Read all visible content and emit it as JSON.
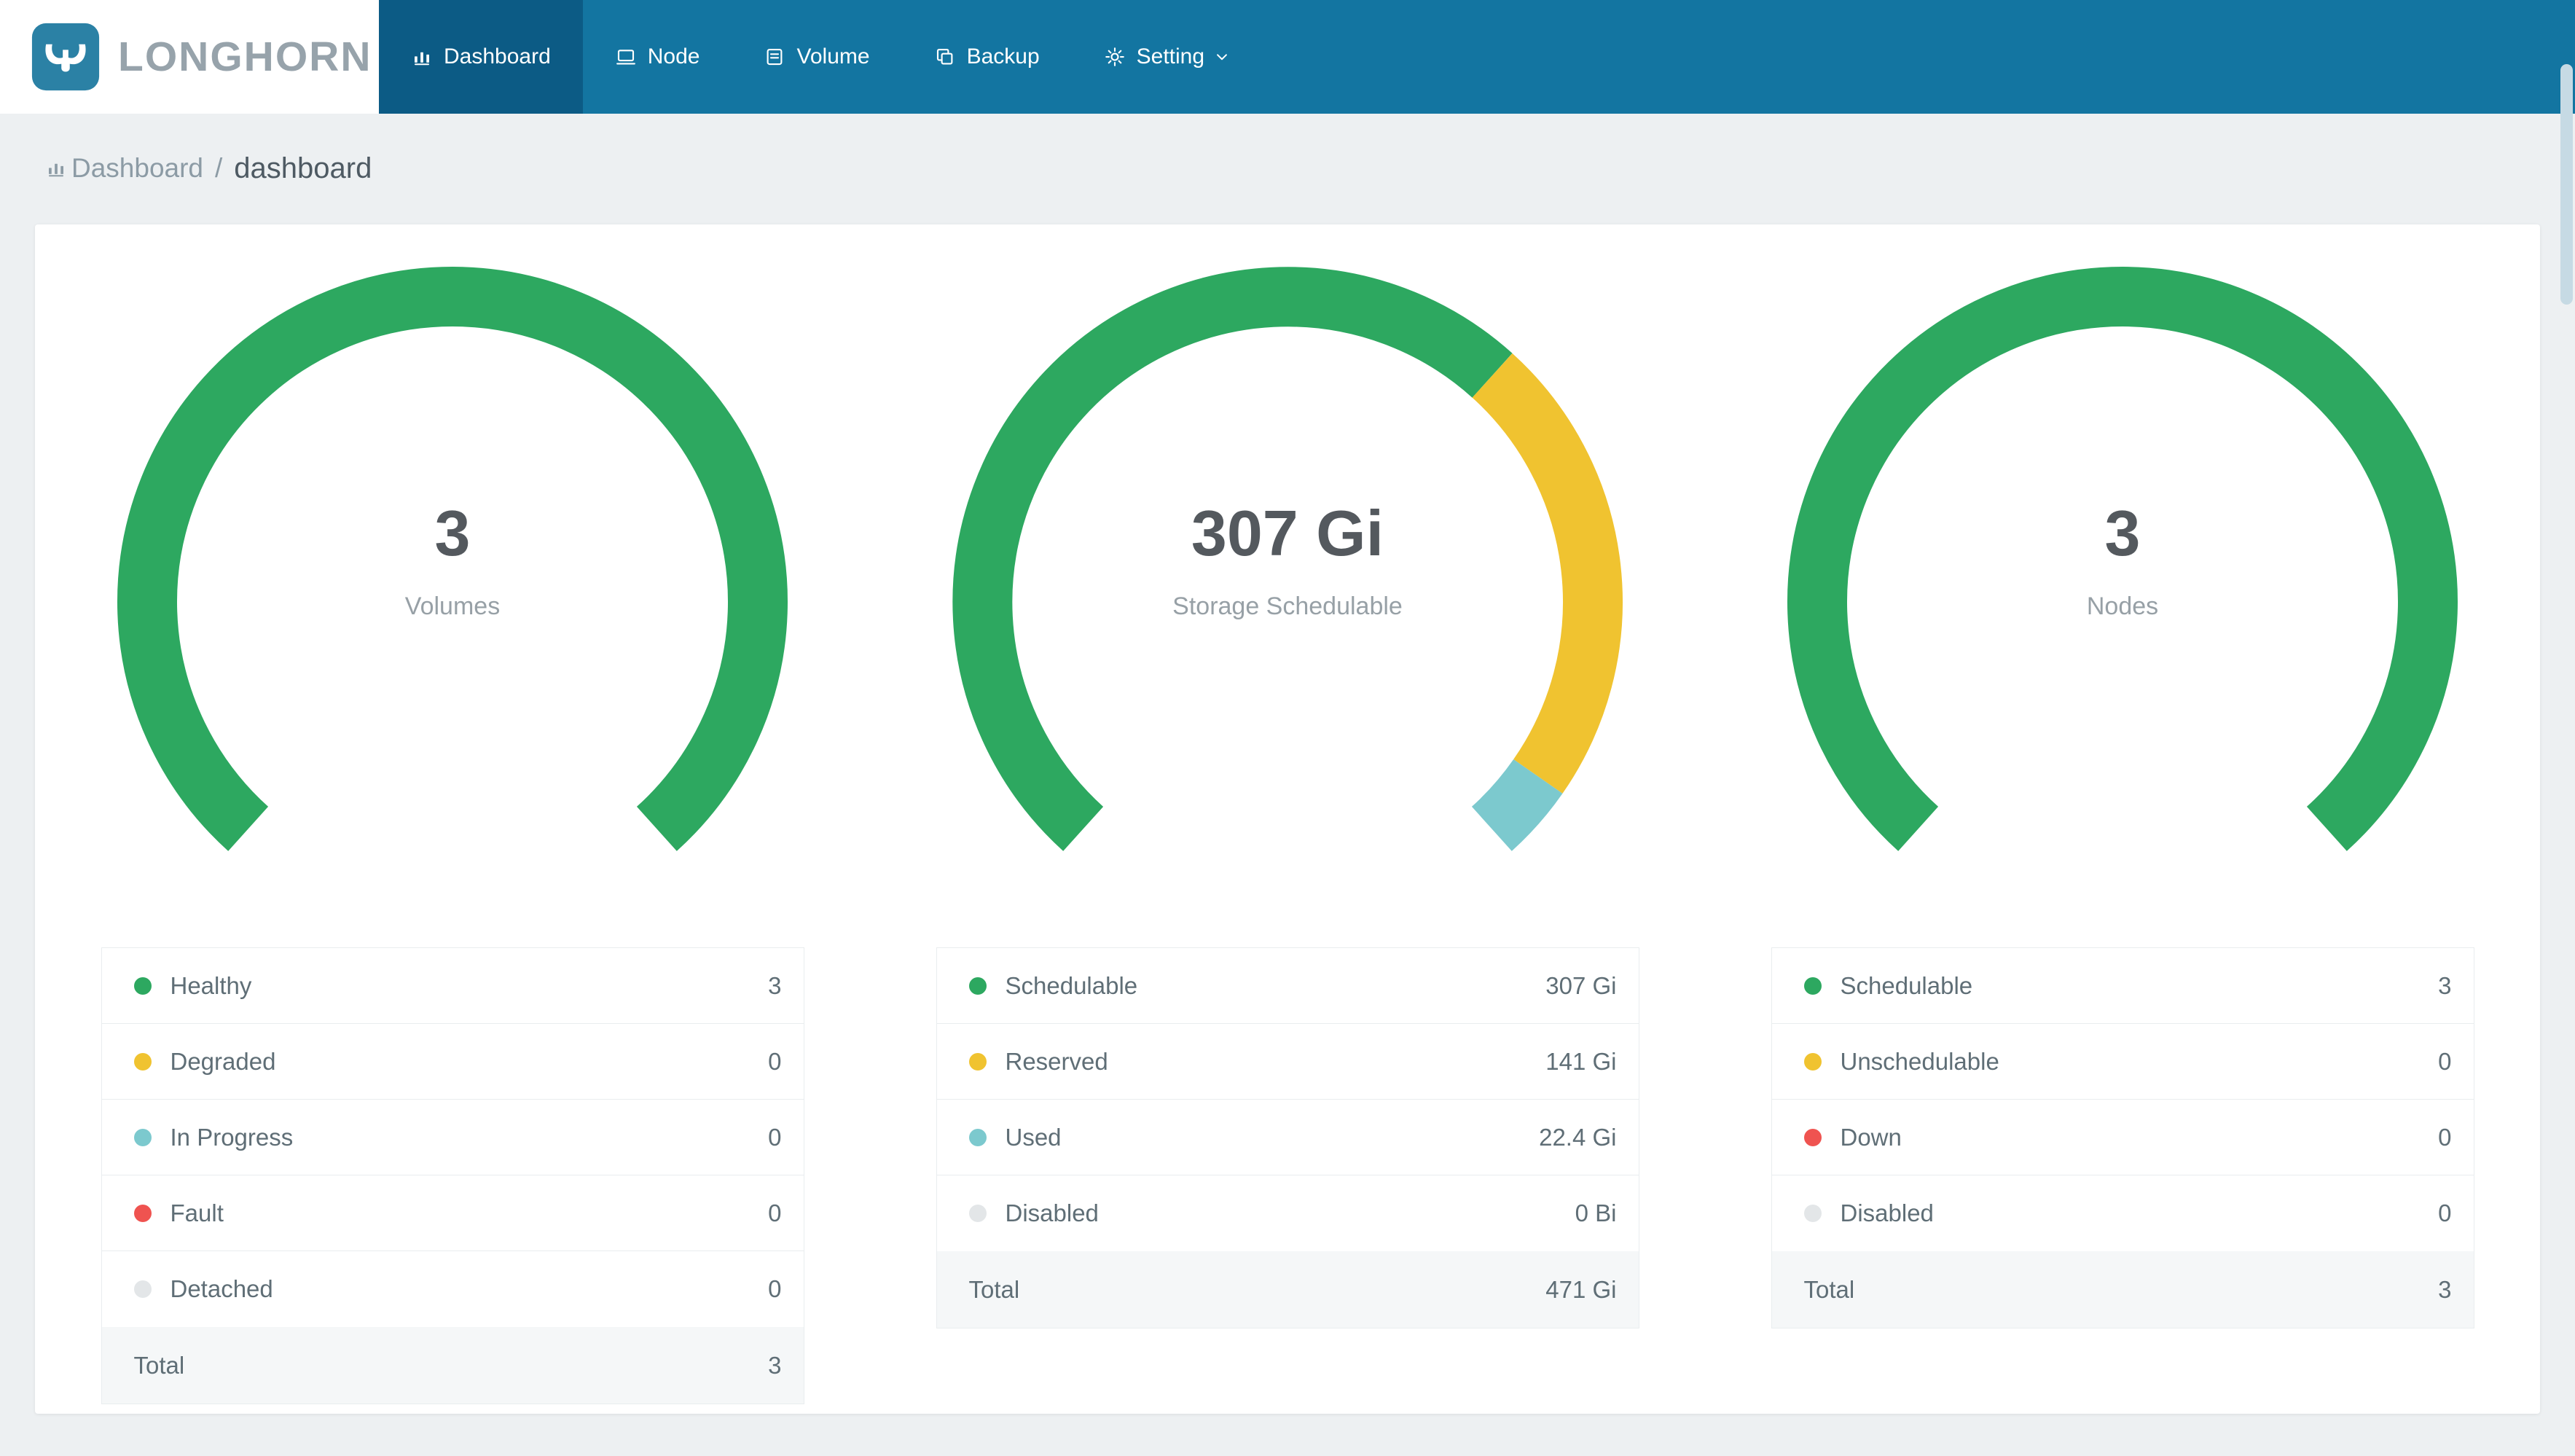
{
  "theme": {
    "navbar_bg": "#1375A1",
    "navbar_active_bg": "#0C5B85",
    "brand_logo_bg": "#2B81A5",
    "page_bg": "#EDF0F2",
    "status_green": "#2DA860",
    "status_yellow": "#F0C330",
    "status_teal": "#7CC9CE",
    "status_red": "#EF5350",
    "status_gray": "#E3E6E8"
  },
  "app": {
    "logo_text": "LONGHORN",
    "nav": [
      {
        "label": "Dashboard",
        "icon": "bar-chart-icon",
        "active": true,
        "has_caret": false
      },
      {
        "label": "Node",
        "icon": "node-icon",
        "active": false,
        "has_caret": false
      },
      {
        "label": "Volume",
        "icon": "volume-icon",
        "active": false,
        "has_caret": false
      },
      {
        "label": "Backup",
        "icon": "backup-icon",
        "active": false,
        "has_caret": false
      },
      {
        "label": "Setting",
        "icon": "gear-icon",
        "active": false,
        "has_caret": true
      }
    ]
  },
  "breadcrumb": {
    "icon": "bar-chart-icon",
    "root": "Dashboard",
    "separator": "/",
    "current": "dashboard"
  },
  "chart_data": [
    {
      "type": "donut-gauge",
      "title": "Volumes",
      "center_value": "3",
      "center_label": "Volumes",
      "segments": [
        {
          "label": "Healthy",
          "value": 3,
          "color": "#2DA860"
        }
      ],
      "legend": [
        {
          "label": "Healthy",
          "value": "3",
          "color": "#2DA860"
        },
        {
          "label": "Degraded",
          "value": "0",
          "color": "#F0C330"
        },
        {
          "label": "In Progress",
          "value": "0",
          "color": "#7CC9CE"
        },
        {
          "label": "Fault",
          "value": "0",
          "color": "#EF5350"
        },
        {
          "label": "Detached",
          "value": "0",
          "color": "#E3E6E8"
        }
      ],
      "total_label": "Total",
      "total_value": "3"
    },
    {
      "type": "donut-gauge",
      "title": "Storage Schedulable",
      "center_value": "307 Gi",
      "center_label": "Storage Schedulable",
      "segments": [
        {
          "label": "Schedulable",
          "value": 307,
          "color": "#2DA860"
        },
        {
          "label": "Reserved",
          "value": 141,
          "color": "#F0C330"
        },
        {
          "label": "Used",
          "value": 22.4,
          "color": "#7CC9CE"
        }
      ],
      "legend": [
        {
          "label": "Schedulable",
          "value": "307 Gi",
          "color": "#2DA860"
        },
        {
          "label": "Reserved",
          "value": "141 Gi",
          "color": "#F0C330"
        },
        {
          "label": "Used",
          "value": "22.4 Gi",
          "color": "#7CC9CE"
        },
        {
          "label": "Disabled",
          "value": "0 Bi",
          "color": "#E3E6E8"
        }
      ],
      "total_label": "Total",
      "total_value": "471 Gi"
    },
    {
      "type": "donut-gauge",
      "title": "Nodes",
      "center_value": "3",
      "center_label": "Nodes",
      "segments": [
        {
          "label": "Schedulable",
          "value": 3,
          "color": "#2DA860"
        }
      ],
      "legend": [
        {
          "label": "Schedulable",
          "value": "3",
          "color": "#2DA860"
        },
        {
          "label": "Unschedulable",
          "value": "0",
          "color": "#F0C330"
        },
        {
          "label": "Down",
          "value": "0",
          "color": "#EF5350"
        },
        {
          "label": "Disabled",
          "value": "0",
          "color": "#E3E6E8"
        }
      ],
      "total_label": "Total",
      "total_value": "3"
    }
  ]
}
